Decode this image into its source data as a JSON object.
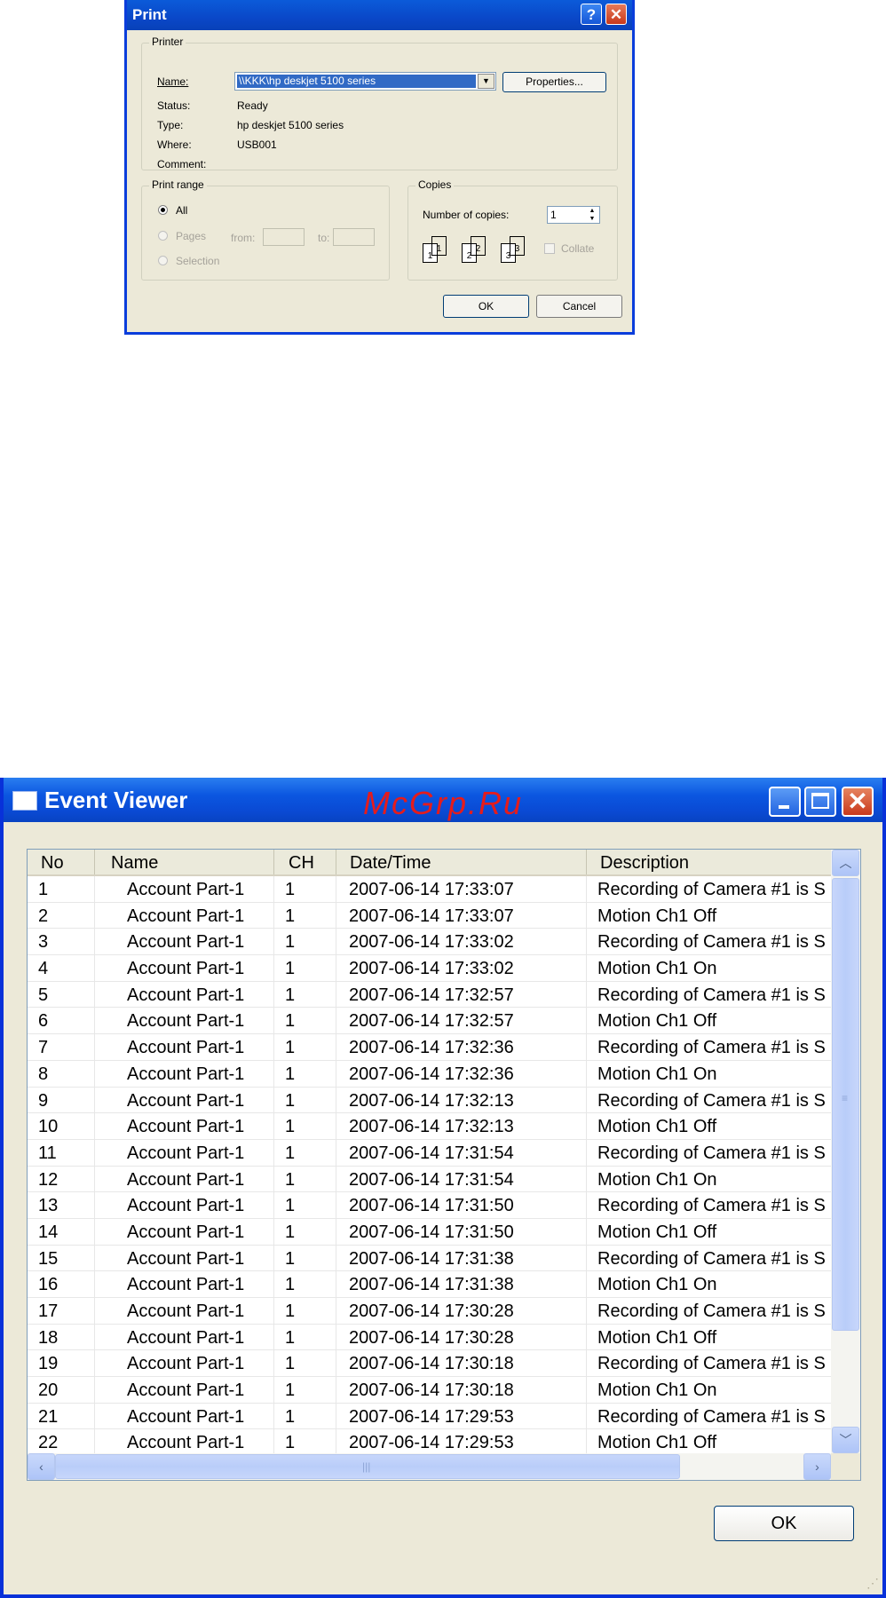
{
  "print_dialog": {
    "title": "Print",
    "printer_group": "Printer",
    "name_label": "Name:",
    "name_value": "\\\\KKK\\hp deskjet 5100 series",
    "properties_button": "Properties...",
    "status_label": "Status:",
    "status_value": "Ready",
    "type_label": "Type:",
    "type_value": "hp deskjet 5100 series",
    "where_label": "Where:",
    "where_value": "USB001",
    "comment_label": "Comment:",
    "range_group": "Print range",
    "range_all": "All",
    "range_pages": "Pages",
    "from_label": "from:",
    "to_label": "to:",
    "range_selection": "Selection",
    "copies_group": "Copies",
    "copies_label": "Number of copies:",
    "copies_value": "1",
    "collate_label": "Collate",
    "ok_button": "OK",
    "cancel_button": "Cancel"
  },
  "event_viewer": {
    "title": "Event Viewer",
    "watermark": "McGrp.Ru",
    "ok_button": "OK",
    "columns": [
      "No",
      "Name",
      "CH",
      "Date/Time",
      "Description"
    ],
    "rows": [
      [
        "1",
        "Account Part-1",
        "1",
        "2007-06-14 17:33:07",
        "Recording of Camera #1 is S"
      ],
      [
        "2",
        "Account Part-1",
        "1",
        "2007-06-14 17:33:07",
        "Motion Ch1 Off"
      ],
      [
        "3",
        "Account Part-1",
        "1",
        "2007-06-14 17:33:02",
        "Recording of Camera #1 is S"
      ],
      [
        "4",
        "Account Part-1",
        "1",
        "2007-06-14 17:33:02",
        "Motion Ch1 On"
      ],
      [
        "5",
        "Account Part-1",
        "1",
        "2007-06-14 17:32:57",
        "Recording of Camera #1 is S"
      ],
      [
        "6",
        "Account Part-1",
        "1",
        "2007-06-14 17:32:57",
        "Motion Ch1 Off"
      ],
      [
        "7",
        "Account Part-1",
        "1",
        "2007-06-14 17:32:36",
        "Recording of Camera #1 is S"
      ],
      [
        "8",
        "Account Part-1",
        "1",
        "2007-06-14 17:32:36",
        "Motion Ch1 On"
      ],
      [
        "9",
        "Account Part-1",
        "1",
        "2007-06-14 17:32:13",
        "Recording of Camera #1 is S"
      ],
      [
        "10",
        "Account Part-1",
        "1",
        "2007-06-14 17:32:13",
        "Motion Ch1 Off"
      ],
      [
        "11",
        "Account Part-1",
        "1",
        "2007-06-14 17:31:54",
        "Recording of Camera #1 is S"
      ],
      [
        "12",
        "Account Part-1",
        "1",
        "2007-06-14 17:31:54",
        "Motion Ch1 On"
      ],
      [
        "13",
        "Account Part-1",
        "1",
        "2007-06-14 17:31:50",
        "Recording of Camera #1 is S"
      ],
      [
        "14",
        "Account Part-1",
        "1",
        "2007-06-14 17:31:50",
        "Motion Ch1 Off"
      ],
      [
        "15",
        "Account Part-1",
        "1",
        "2007-06-14 17:31:38",
        "Recording of Camera #1 is S"
      ],
      [
        "16",
        "Account Part-1",
        "1",
        "2007-06-14 17:31:38",
        "Motion Ch1 On"
      ],
      [
        "17",
        "Account Part-1",
        "1",
        "2007-06-14 17:30:28",
        "Recording of Camera #1 is S"
      ],
      [
        "18",
        "Account Part-1",
        "1",
        "2007-06-14 17:30:28",
        "Motion Ch1 Off"
      ],
      [
        "19",
        "Account Part-1",
        "1",
        "2007-06-14 17:30:18",
        "Recording of Camera #1 is S"
      ],
      [
        "20",
        "Account Part-1",
        "1",
        "2007-06-14 17:30:18",
        "Motion Ch1 On"
      ],
      [
        "21",
        "Account Part-1",
        "1",
        "2007-06-14 17:29:53",
        "Recording of Camera #1 is S"
      ],
      [
        "22",
        "Account Part-1",
        "1",
        "2007-06-14 17:29:53",
        "Motion Ch1 Off"
      ]
    ]
  }
}
